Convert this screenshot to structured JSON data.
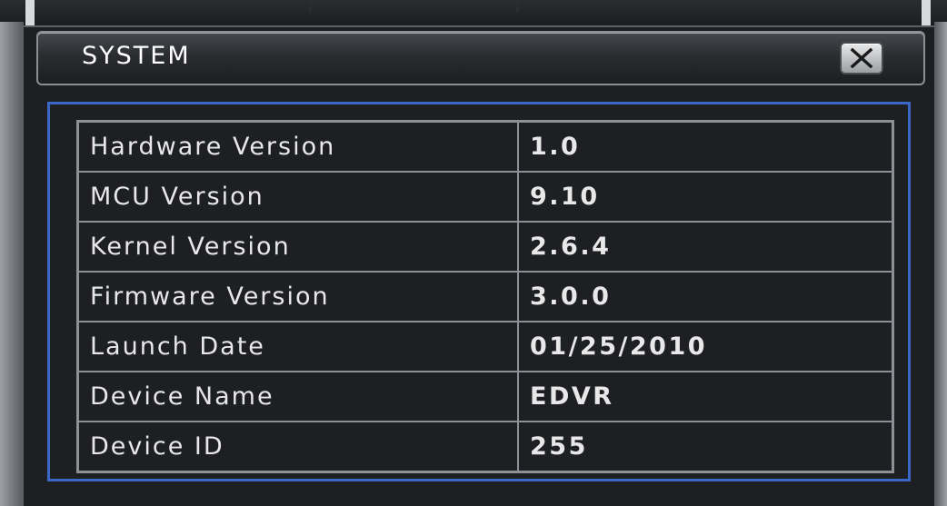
{
  "window": {
    "title": "SYSTEM",
    "close_icon": "close-x-icon"
  },
  "system_info": {
    "rows": [
      {
        "label": "Hardware Version",
        "value": "1.0"
      },
      {
        "label": "MCU Version",
        "value": "9.10"
      },
      {
        "label": "Kernel Version",
        "value": "2.6.4"
      },
      {
        "label": "Firmware Version",
        "value": "3.0.0"
      },
      {
        "label": "Launch Date",
        "value": "01/25/2010"
      },
      {
        "label": "Device Name",
        "value": "EDVR"
      },
      {
        "label": "Device ID",
        "value": "255"
      }
    ]
  },
  "colors": {
    "frame_accent": "#3b68c6",
    "panel_background": "#1d1f23",
    "text": "#e8e8e8"
  }
}
